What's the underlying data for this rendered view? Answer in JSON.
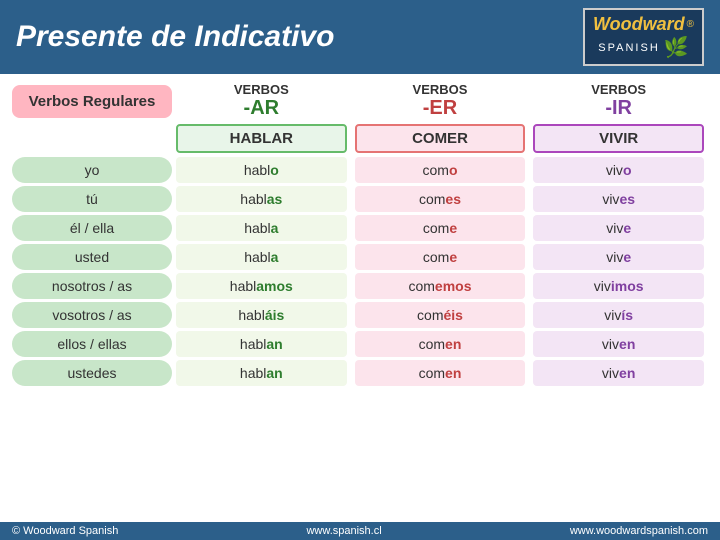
{
  "header": {
    "title": "Presente de Indicativo",
    "logo": {
      "name": "Woodward",
      "registered": "®",
      "spanish": "SPANISH"
    }
  },
  "verbos_regulares_label": "Verbos Regulares",
  "columns": [
    {
      "id": "ar",
      "label": "VERBOS",
      "ending": "-AR",
      "example": "HABLAR"
    },
    {
      "id": "er",
      "label": "VERBOS",
      "ending": "-ER",
      "example": "COMER"
    },
    {
      "id": "ir",
      "label": "VERBOS",
      "ending": "-IR",
      "example": "VIVIR"
    }
  ],
  "rows": [
    {
      "pronoun": "yo",
      "ar": {
        "stem": "habl",
        "ending": "o"
      },
      "er": {
        "stem": "com",
        "ending": "o"
      },
      "ir": {
        "stem": "viv",
        "ending": "o"
      }
    },
    {
      "pronoun": "tú",
      "ar": {
        "stem": "habl",
        "ending": "as"
      },
      "er": {
        "stem": "com",
        "ending": "es"
      },
      "ir": {
        "stem": "viv",
        "ending": "es"
      }
    },
    {
      "pronoun": "él / ella",
      "ar": {
        "stem": "habl",
        "ending": "a"
      },
      "er": {
        "stem": "com",
        "ending": "e"
      },
      "ir": {
        "stem": "viv",
        "ending": "e"
      }
    },
    {
      "pronoun": "usted",
      "ar": {
        "stem": "habl",
        "ending": "a"
      },
      "er": {
        "stem": "com",
        "ending": "e"
      },
      "ir": {
        "stem": "viv",
        "ending": "e"
      }
    },
    {
      "pronoun": "nosotros / as",
      "ar": {
        "stem": "habl",
        "ending": "amos"
      },
      "er": {
        "stem": "com",
        "ending": "emos"
      },
      "ir": {
        "stem": "viv",
        "ending": "imos"
      }
    },
    {
      "pronoun": "vosotros / as",
      "ar": {
        "stem": "habl",
        "ending": "áis"
      },
      "er": {
        "stem": "com",
        "ending": "éis"
      },
      "ir": {
        "stem": "viv",
        "ending": "ís"
      }
    },
    {
      "pronoun": "ellos / ellas",
      "ar": {
        "stem": "habl",
        "ending": "an"
      },
      "er": {
        "stem": "com",
        "ending": "en"
      },
      "ir": {
        "stem": "viv",
        "ending": "en"
      }
    },
    {
      "pronoun": "ustedes",
      "ar": {
        "stem": "habl",
        "ending": "an"
      },
      "er": {
        "stem": "com",
        "ending": "en"
      },
      "ir": {
        "stem": "viv",
        "ending": "en"
      }
    }
  ],
  "footer": {
    "left": "© Woodward Spanish",
    "center": "www.spanish.cl",
    "right": "www.woodwardspanish.com"
  }
}
